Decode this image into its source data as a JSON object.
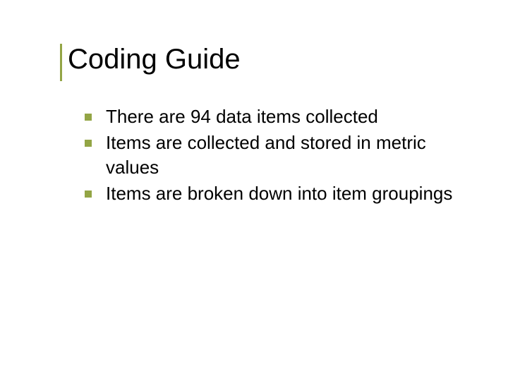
{
  "title": "Coding Guide",
  "bullets": {
    "items": [
      {
        "text": "There are 94 data items collected"
      },
      {
        "text": "Items are collected and stored in metric values"
      },
      {
        "text": "Items are broken down into item groupings"
      }
    ]
  }
}
